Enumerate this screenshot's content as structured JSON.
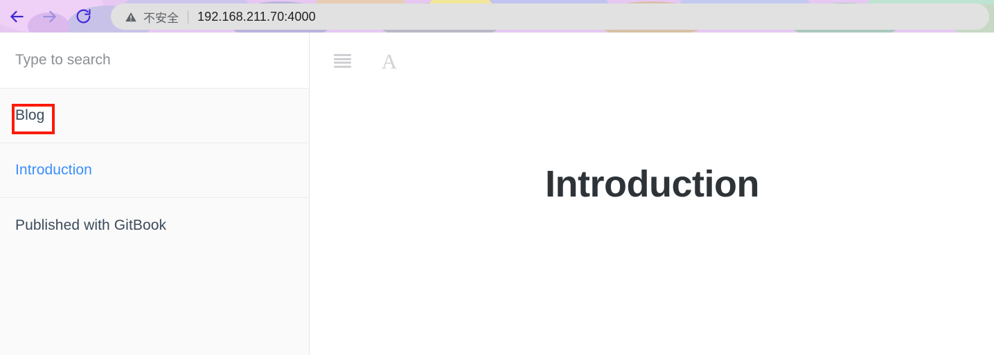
{
  "browser": {
    "back_icon": "back-arrow-icon",
    "forward_icon": "forward-arrow-icon",
    "reload_icon": "reload-icon",
    "security": {
      "icon": "warning-triangle-icon",
      "label": "不安全"
    },
    "url": "192.168.211.70:4000",
    "colors": {
      "back_arrow": "#3c28d0",
      "forward_arrow": "#9a8fe0",
      "reload": "#4028d8",
      "omnibox_bg": "#e1e1e1",
      "chrome_bg": "#e6c8f2"
    }
  },
  "sidebar": {
    "search": {
      "placeholder": "Type to search",
      "value": ""
    },
    "items": [
      {
        "label": "Blog",
        "type": "heading",
        "annotated": true
      },
      {
        "label": "Introduction",
        "type": "link",
        "annotated": false
      },
      {
        "label": "Published with GitBook",
        "type": "footer",
        "annotated": false
      }
    ],
    "annotation_color": "#fc1a07"
  },
  "content": {
    "toolbar": {
      "menu_icon": "hamburger-menu-icon",
      "font_icon": "font-size-icon",
      "font_icon_glyph": "A"
    },
    "title": "Introduction"
  }
}
